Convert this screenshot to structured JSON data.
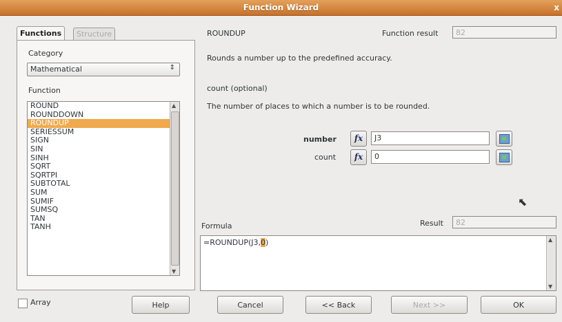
{
  "window": {
    "title": "Function Wizard",
    "close_glyph": "x"
  },
  "tabs": {
    "functions": "Functions",
    "structure": "Structure"
  },
  "left": {
    "category_label": "Category",
    "category_value": "Mathematical",
    "function_label": "Function",
    "functions": [
      "ROUND",
      "ROUNDDOWN",
      "ROUNDUP",
      "SERIESSUM",
      "SIGN",
      "SIN",
      "SINH",
      "SQRT",
      "SQRTPI",
      "SUBTOTAL",
      "SUM",
      "SUMIF",
      "SUMSQ",
      "TAN",
      "TANH"
    ],
    "selected_index": 2
  },
  "right": {
    "function_name": "ROUNDUP",
    "result_label": "Function result",
    "result_value": "82",
    "description": "Rounds a number up to the predefined accuracy.",
    "param_title": "count (optional)",
    "param_description": "The number of places to which a number is to be rounded.",
    "params": [
      {
        "label": "number",
        "value": "J3"
      },
      {
        "label": "count",
        "value": "0"
      }
    ],
    "fx_glyph": "fx",
    "formula_label": "Formula",
    "formula_result_label": "Result",
    "formula_result_value": "82",
    "formula_text_a": "=ROUNDUP(J3,",
    "formula_text_hl": "0",
    "formula_text_b": ")"
  },
  "bottom": {
    "array_label": "Array",
    "help": "Help",
    "cancel": "Cancel",
    "back": "<< Back",
    "next": "Next >>",
    "ok": "OK"
  },
  "colors": {
    "title_bar": "#d48838",
    "selection": "#f0a94e"
  }
}
